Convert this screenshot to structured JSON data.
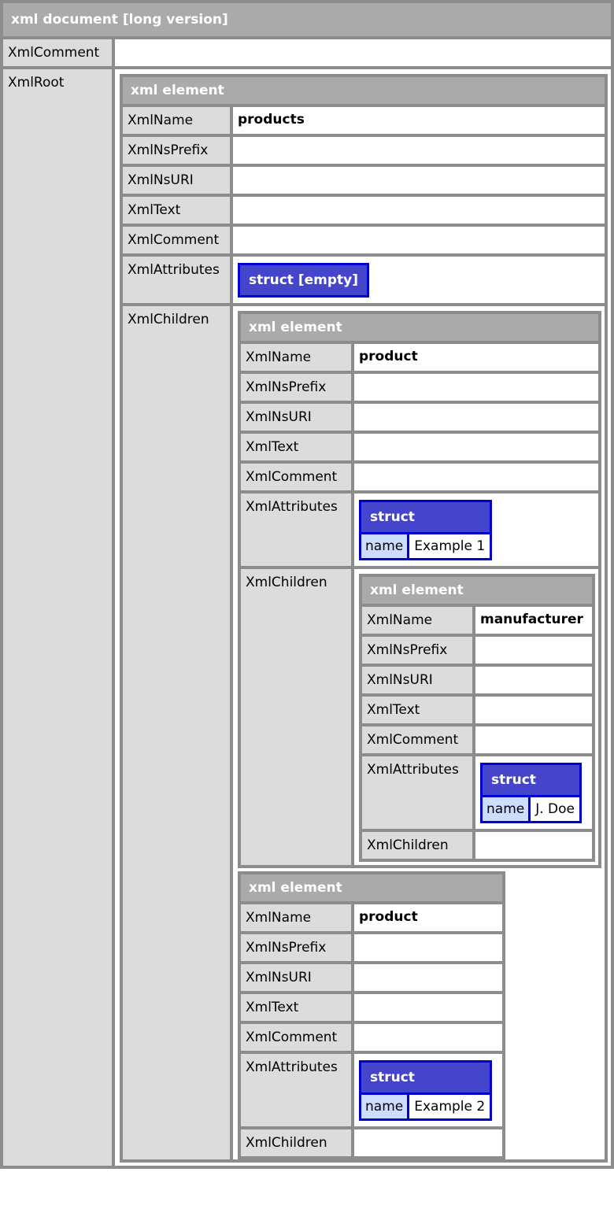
{
  "document": {
    "title": "xml document [long version]",
    "comment_key": "XmlComment",
    "comment_value": "",
    "root_key": "XmlRoot"
  },
  "labels": {
    "element": "xml element",
    "name": "XmlName",
    "ns_prefix": "XmlNsPrefix",
    "ns_uri": "XmlNsURI",
    "text": "XmlText",
    "comment": "XmlComment",
    "attributes": "XmlAttributes",
    "children": "XmlChildren",
    "struct": "struct",
    "struct_empty": "struct [empty]"
  },
  "root": {
    "name": "products",
    "ns_prefix": "",
    "ns_uri": "",
    "text": "",
    "comment": ""
  },
  "product1": {
    "name": "product",
    "attr_key": "name",
    "attr_value": "Example 1"
  },
  "manufacturer": {
    "name": "manufacturer",
    "attr_key": "name",
    "attr_value": "J. Doe"
  },
  "product2": {
    "name": "product",
    "attr_key": "name",
    "attr_value": "Example 2"
  }
}
